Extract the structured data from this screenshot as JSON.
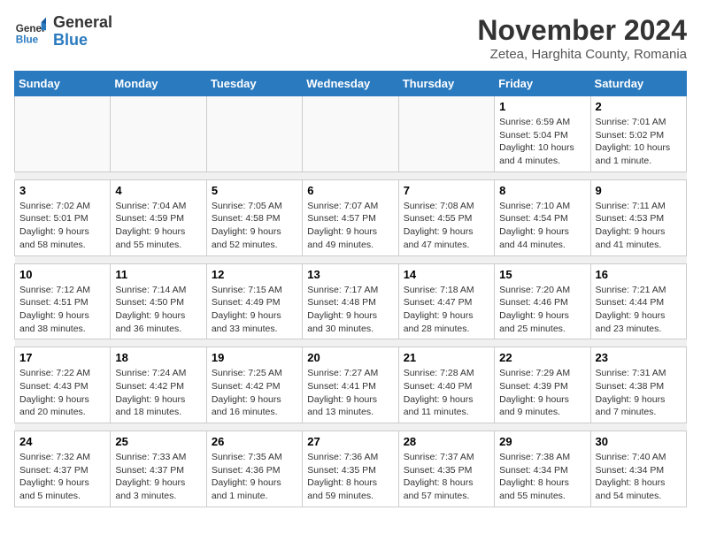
{
  "logo": {
    "text_general": "General",
    "text_blue": "Blue"
  },
  "header": {
    "title": "November 2024",
    "subtitle": "Zetea, Harghita County, Romania"
  },
  "days_of_week": [
    "Sunday",
    "Monday",
    "Tuesday",
    "Wednesday",
    "Thursday",
    "Friday",
    "Saturday"
  ],
  "weeks": [
    {
      "days": [
        {
          "num": "",
          "info": ""
        },
        {
          "num": "",
          "info": ""
        },
        {
          "num": "",
          "info": ""
        },
        {
          "num": "",
          "info": ""
        },
        {
          "num": "",
          "info": ""
        },
        {
          "num": "1",
          "info": "Sunrise: 6:59 AM\nSunset: 5:04 PM\nDaylight: 10 hours and 4 minutes."
        },
        {
          "num": "2",
          "info": "Sunrise: 7:01 AM\nSunset: 5:02 PM\nDaylight: 10 hours and 1 minute."
        }
      ]
    },
    {
      "days": [
        {
          "num": "3",
          "info": "Sunrise: 7:02 AM\nSunset: 5:01 PM\nDaylight: 9 hours and 58 minutes."
        },
        {
          "num": "4",
          "info": "Sunrise: 7:04 AM\nSunset: 4:59 PM\nDaylight: 9 hours and 55 minutes."
        },
        {
          "num": "5",
          "info": "Sunrise: 7:05 AM\nSunset: 4:58 PM\nDaylight: 9 hours and 52 minutes."
        },
        {
          "num": "6",
          "info": "Sunrise: 7:07 AM\nSunset: 4:57 PM\nDaylight: 9 hours and 49 minutes."
        },
        {
          "num": "7",
          "info": "Sunrise: 7:08 AM\nSunset: 4:55 PM\nDaylight: 9 hours and 47 minutes."
        },
        {
          "num": "8",
          "info": "Sunrise: 7:10 AM\nSunset: 4:54 PM\nDaylight: 9 hours and 44 minutes."
        },
        {
          "num": "9",
          "info": "Sunrise: 7:11 AM\nSunset: 4:53 PM\nDaylight: 9 hours and 41 minutes."
        }
      ]
    },
    {
      "days": [
        {
          "num": "10",
          "info": "Sunrise: 7:12 AM\nSunset: 4:51 PM\nDaylight: 9 hours and 38 minutes."
        },
        {
          "num": "11",
          "info": "Sunrise: 7:14 AM\nSunset: 4:50 PM\nDaylight: 9 hours and 36 minutes."
        },
        {
          "num": "12",
          "info": "Sunrise: 7:15 AM\nSunset: 4:49 PM\nDaylight: 9 hours and 33 minutes."
        },
        {
          "num": "13",
          "info": "Sunrise: 7:17 AM\nSunset: 4:48 PM\nDaylight: 9 hours and 30 minutes."
        },
        {
          "num": "14",
          "info": "Sunrise: 7:18 AM\nSunset: 4:47 PM\nDaylight: 9 hours and 28 minutes."
        },
        {
          "num": "15",
          "info": "Sunrise: 7:20 AM\nSunset: 4:46 PM\nDaylight: 9 hours and 25 minutes."
        },
        {
          "num": "16",
          "info": "Sunrise: 7:21 AM\nSunset: 4:44 PM\nDaylight: 9 hours and 23 minutes."
        }
      ]
    },
    {
      "days": [
        {
          "num": "17",
          "info": "Sunrise: 7:22 AM\nSunset: 4:43 PM\nDaylight: 9 hours and 20 minutes."
        },
        {
          "num": "18",
          "info": "Sunrise: 7:24 AM\nSunset: 4:42 PM\nDaylight: 9 hours and 18 minutes."
        },
        {
          "num": "19",
          "info": "Sunrise: 7:25 AM\nSunset: 4:42 PM\nDaylight: 9 hours and 16 minutes."
        },
        {
          "num": "20",
          "info": "Sunrise: 7:27 AM\nSunset: 4:41 PM\nDaylight: 9 hours and 13 minutes."
        },
        {
          "num": "21",
          "info": "Sunrise: 7:28 AM\nSunset: 4:40 PM\nDaylight: 9 hours and 11 minutes."
        },
        {
          "num": "22",
          "info": "Sunrise: 7:29 AM\nSunset: 4:39 PM\nDaylight: 9 hours and 9 minutes."
        },
        {
          "num": "23",
          "info": "Sunrise: 7:31 AM\nSunset: 4:38 PM\nDaylight: 9 hours and 7 minutes."
        }
      ]
    },
    {
      "days": [
        {
          "num": "24",
          "info": "Sunrise: 7:32 AM\nSunset: 4:37 PM\nDaylight: 9 hours and 5 minutes."
        },
        {
          "num": "25",
          "info": "Sunrise: 7:33 AM\nSunset: 4:37 PM\nDaylight: 9 hours and 3 minutes."
        },
        {
          "num": "26",
          "info": "Sunrise: 7:35 AM\nSunset: 4:36 PM\nDaylight: 9 hours and 1 minute."
        },
        {
          "num": "27",
          "info": "Sunrise: 7:36 AM\nSunset: 4:35 PM\nDaylight: 8 hours and 59 minutes."
        },
        {
          "num": "28",
          "info": "Sunrise: 7:37 AM\nSunset: 4:35 PM\nDaylight: 8 hours and 57 minutes."
        },
        {
          "num": "29",
          "info": "Sunrise: 7:38 AM\nSunset: 4:34 PM\nDaylight: 8 hours and 55 minutes."
        },
        {
          "num": "30",
          "info": "Sunrise: 7:40 AM\nSunset: 4:34 PM\nDaylight: 8 hours and 54 minutes."
        }
      ]
    }
  ]
}
